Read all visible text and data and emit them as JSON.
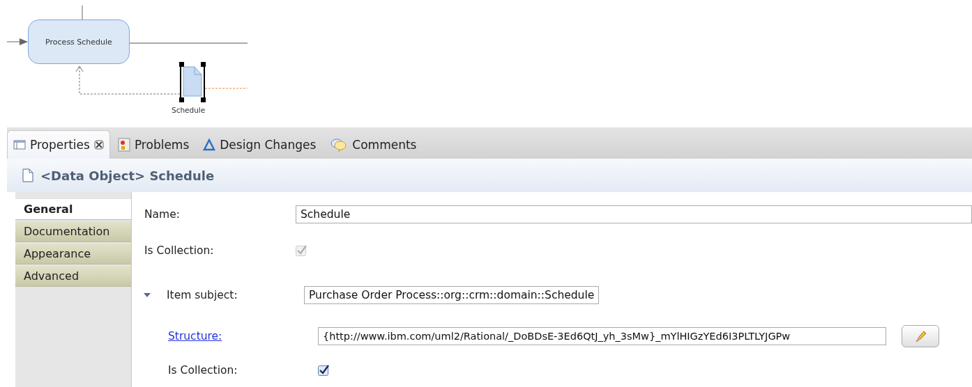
{
  "diagram": {
    "task": {
      "label": "Process Schedule"
    },
    "data_object": {
      "label": "Schedule",
      "selected": true
    }
  },
  "tabs": [
    {
      "label": "Properties",
      "kind": "properties",
      "selected": true,
      "closable": true
    },
    {
      "label": "Problems",
      "kind": "problems",
      "selected": false,
      "closable": false
    },
    {
      "label": "Design Changes",
      "kind": "changes",
      "selected": false,
      "closable": false
    },
    {
      "label": "Comments",
      "kind": "comments",
      "selected": false,
      "closable": false
    }
  ],
  "header": {
    "title": "<Data Object> Schedule"
  },
  "sections": [
    {
      "label": "General",
      "selected": true
    },
    {
      "label": "Documentation",
      "selected": false
    },
    {
      "label": "Appearance",
      "selected": false
    },
    {
      "label": "Advanced",
      "selected": false
    }
  ],
  "form": {
    "name": {
      "label": "Name:",
      "value": "Schedule"
    },
    "is_collection": {
      "label": "Is Collection:",
      "checked": true,
      "disabled": true
    },
    "item_subject": {
      "label": "Item subject:",
      "expanded": true,
      "value": "Purchase Order Process::org::crm::domain::Schedule"
    },
    "structure": {
      "label": "Structure:",
      "value": "{http://www.ibm.com/uml2/Rational/_DoBDsE-3Ed6QtJ_yh_3sMw}_mYlHIGzYEd6I3PLTLYJGPw"
    },
    "item_is_collection": {
      "label": "Is Collection:",
      "checked": true,
      "disabled": false
    }
  }
}
